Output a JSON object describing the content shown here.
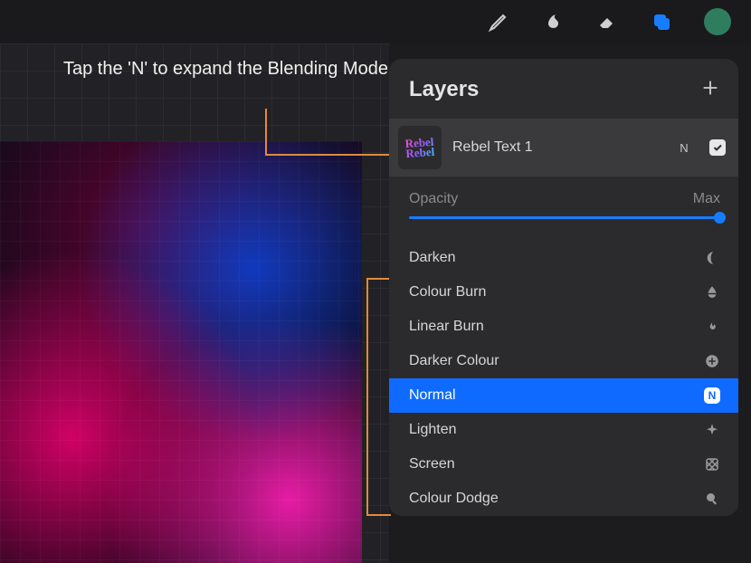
{
  "instruction": "Tap the 'N' to expand the Blending Mode options",
  "toolbar": {
    "icons": [
      "brush-icon",
      "smudge-icon",
      "eraser-icon",
      "layers-icon",
      "avatar"
    ]
  },
  "panel": {
    "title": "Layers",
    "layer": {
      "name": "Rebel Text 1",
      "blend_letter": "N",
      "visible": true,
      "thumb_text": "Rebel Rebel"
    },
    "opacity": {
      "label": "Opacity",
      "value": "Max"
    },
    "blend_modes": [
      {
        "name": "Darken",
        "icon": "moon-icon",
        "selected": false
      },
      {
        "name": "Colour Burn",
        "icon": "drop-icon",
        "selected": false
      },
      {
        "name": "Linear Burn",
        "icon": "flame-icon",
        "selected": false
      },
      {
        "name": "Darker Colour",
        "icon": "plus-circle-icon",
        "selected": false
      },
      {
        "name": "Normal",
        "icon": "n-badge-icon",
        "selected": true
      },
      {
        "name": "Lighten",
        "icon": "sparkle-icon",
        "selected": false
      },
      {
        "name": "Screen",
        "icon": "hatch-icon",
        "selected": false
      },
      {
        "name": "Colour Dodge",
        "icon": "magnify-icon",
        "selected": false
      }
    ]
  },
  "colors": {
    "accent": "#0f6bff",
    "callout": "#e08a3e",
    "panel": "#2b2b2d"
  }
}
